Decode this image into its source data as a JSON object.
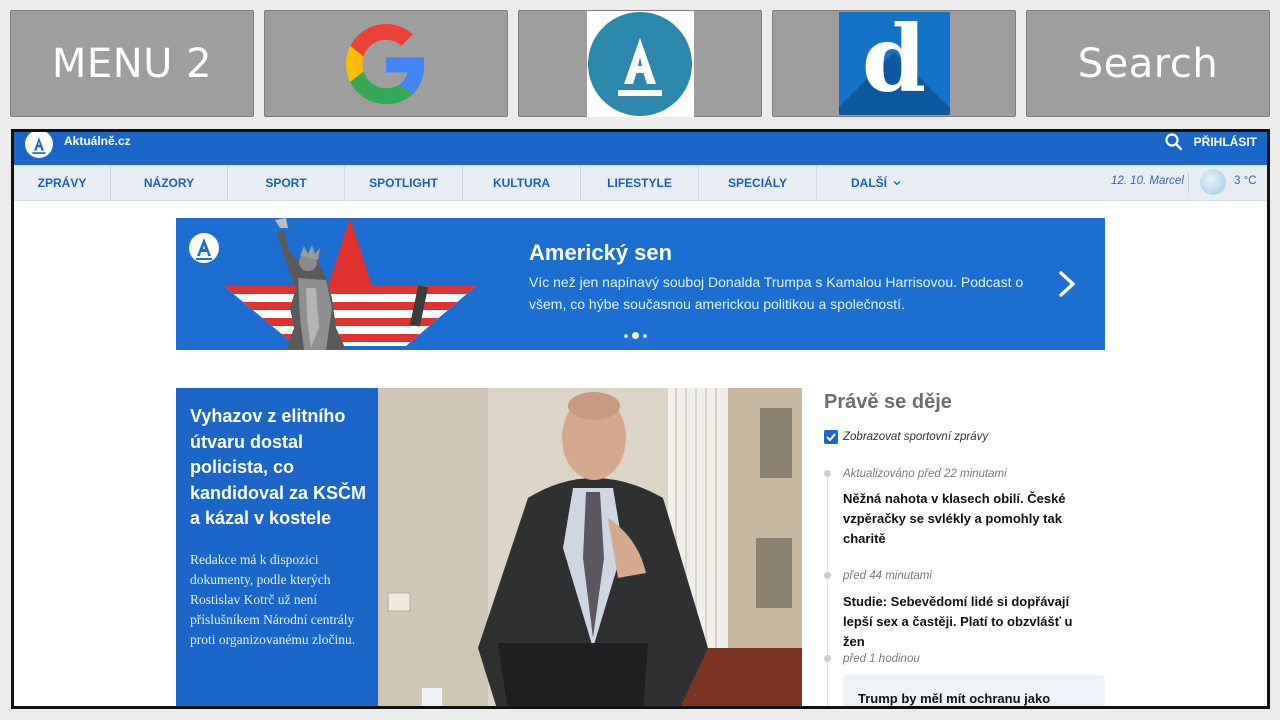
{
  "launcher": {
    "menu_label": "MENU 2",
    "google_icon": "google-g-logo",
    "aktualne_icon": "aktualne-a-logo",
    "denik_icon": "d-logo",
    "denik_letter": "d",
    "search_label": "Search"
  },
  "site": {
    "name": "Aktuálně.cz",
    "login": "PŘIHLÁSIT",
    "brand_color": "#1b66c9"
  },
  "nav": {
    "items": [
      "ZPRÁVY",
      "NÁZORY",
      "SPORT",
      "SPOTLIGHT",
      "KULTURA",
      "LIFESTYLE",
      "SPECIÁLY",
      "DALŠÍ"
    ],
    "date": "12. 10. Marcel",
    "temperature": "3 °C"
  },
  "promo": {
    "title": "Americký sen",
    "description": "Víc než jen napínavý souboj Donalda Trumpa s Kamalou Harrisovou. Podcast o všem, co hýbe současnou americkou politikou a společností.",
    "active_slide": 2,
    "slide_count": 3
  },
  "lead": {
    "title": "Vyhazov z elitního útvaru dostal policista, co kandidoval za KSČM a kázal v kostele",
    "description": "Redakce má k dispozici dokumenty, podle kterých Rostislav Kotrč už není příslušníkem Národní centrály proti organizovanému zločinu."
  },
  "live": {
    "title": "Právě se děje",
    "checkbox_label": "Zobrazovat sportovní zprávy",
    "checkbox_checked": true,
    "items": [
      {
        "time": "Aktualizováno před 22 minutami",
        "title": "Něžná nahota v klasech obilí. České vzpěračky se svlékly a pomohly tak charitě"
      },
      {
        "time": "před 44 minutami",
        "title": "Studie: Sebevědomí lidé si dopřávají lepší sex a častěji. Platí to obzvlášť u žen"
      },
      {
        "time": "před 1 hodinou",
        "title": "Trump by měl mít ochranu jako"
      }
    ]
  }
}
